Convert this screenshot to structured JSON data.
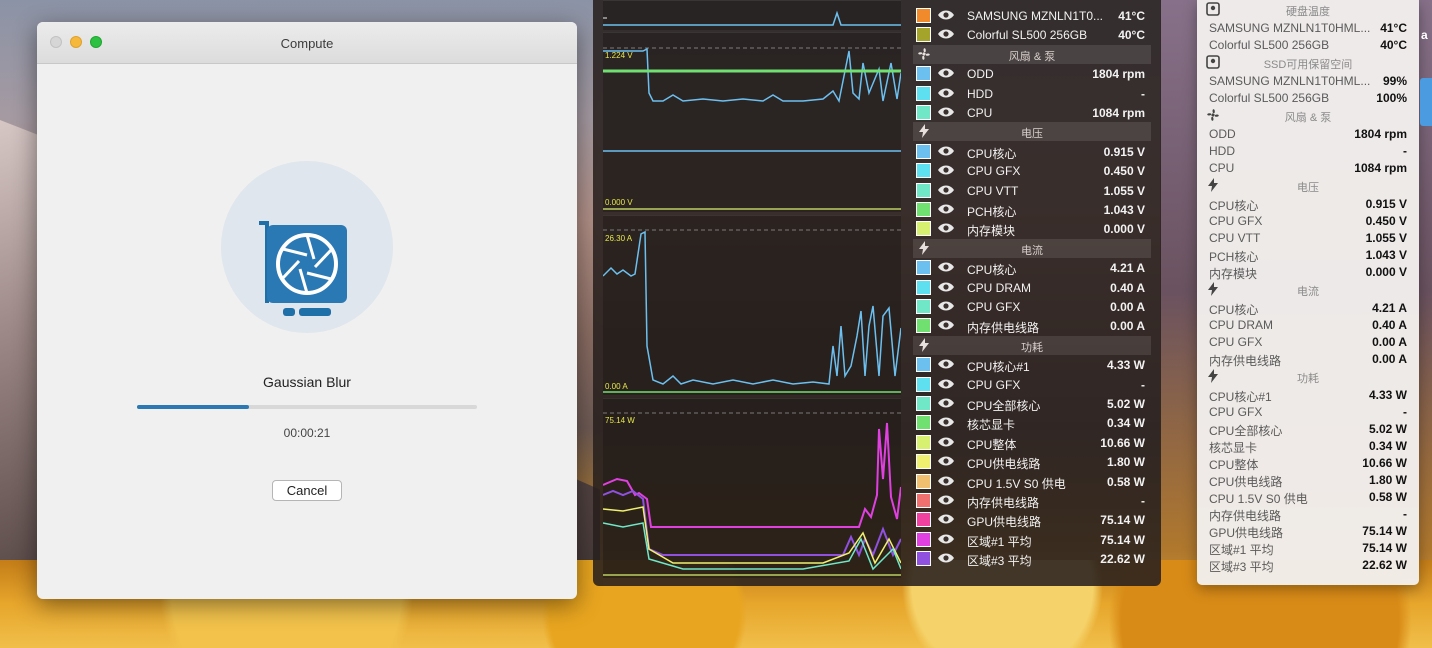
{
  "window": {
    "title": "Compute",
    "task": "Gaussian Blur",
    "progress": 0.33,
    "elapsed": "00:00:21",
    "cancel_label": "Cancel",
    "accent": "#2a79b5"
  },
  "graphs": {
    "voltage_top": "1.224 V",
    "voltage_bottom": "0.000 V",
    "current_top": "26.30 A",
    "current_bottom": "0.00 A",
    "power_top": "75.14 W"
  },
  "istat": {
    "sections": [
      {
        "kind": "row",
        "label": "SAMSUNG MZNLN1T0...",
        "value": "41°C",
        "color": "#f08a2a"
      },
      {
        "kind": "row",
        "label": "Colorful SL500 256GB",
        "value": "40°C",
        "color": "#a4a42a"
      },
      {
        "kind": "header",
        "label": "风扇 & 泵",
        "icon": "fan-icon"
      },
      {
        "kind": "row",
        "label": "ODD",
        "value": "1804 rpm",
        "color": "#6cc0f0"
      },
      {
        "kind": "row",
        "label": "HDD",
        "value": "-",
        "color": "#5fe0f0"
      },
      {
        "kind": "row",
        "label": "CPU",
        "value": "1084 rpm",
        "color": "#70e8c8"
      },
      {
        "kind": "header",
        "label": "电压",
        "icon": "lightning-icon"
      },
      {
        "kind": "row",
        "label": "CPU核心",
        "value": "0.915 V",
        "color": "#6cc0f0"
      },
      {
        "kind": "row",
        "label": "CPU GFX",
        "value": "0.450 V",
        "color": "#5fe0f0"
      },
      {
        "kind": "row",
        "label": "CPU VTT",
        "value": "1.055 V",
        "color": "#70e8c8"
      },
      {
        "kind": "row",
        "label": "PCH核心",
        "value": "1.043 V",
        "color": "#70e070"
      },
      {
        "kind": "row",
        "label": "内存模块",
        "value": "0.000 V",
        "color": "#d8f070"
      },
      {
        "kind": "header",
        "label": "电流",
        "icon": "lightning-icon"
      },
      {
        "kind": "row",
        "label": "CPU核心",
        "value": "4.21 A",
        "color": "#6cc0f0"
      },
      {
        "kind": "row",
        "label": "CPU DRAM",
        "value": "0.40 A",
        "color": "#5fe0f0"
      },
      {
        "kind": "row",
        "label": "CPU GFX",
        "value": "0.00 A",
        "color": "#70e8c8"
      },
      {
        "kind": "row",
        "label": "内存供电线路",
        "value": "0.00 A",
        "color": "#70e070"
      },
      {
        "kind": "header",
        "label": "功耗",
        "icon": "lightning-icon"
      },
      {
        "kind": "row",
        "label": "CPU核心#1",
        "value": "4.33 W",
        "color": "#6cc0f0"
      },
      {
        "kind": "row",
        "label": "CPU GFX",
        "value": "-",
        "color": "#5fe0f0"
      },
      {
        "kind": "row",
        "label": "CPU全部核心",
        "value": "5.02 W",
        "color": "#70e8c8"
      },
      {
        "kind": "row",
        "label": "核芯显卡",
        "value": "0.34 W",
        "color": "#70e070"
      },
      {
        "kind": "row",
        "label": "CPU整体",
        "value": "10.66 W",
        "color": "#d8f070"
      },
      {
        "kind": "row",
        "label": "CPU供电线路",
        "value": "1.80 W",
        "color": "#f0f070"
      },
      {
        "kind": "row",
        "label": "CPU 1.5V S0 供电",
        "value": "0.58 W",
        "color": "#f0c070"
      },
      {
        "kind": "row",
        "label": "内存供电线路",
        "value": "-",
        "color": "#f07070"
      },
      {
        "kind": "row",
        "label": "GPU供电线路",
        "value": "75.14 W",
        "color": "#f040a0"
      },
      {
        "kind": "row",
        "label": "区域#1 平均",
        "value": "75.14 W",
        "color": "#e040e0"
      },
      {
        "kind": "row",
        "label": "区域#3 平均",
        "value": "22.62 W",
        "color": "#9050e0"
      }
    ]
  },
  "dropdown": {
    "sections": [
      {
        "kind": "header",
        "label": "硬盘温度",
        "icon": "drive-icon"
      },
      {
        "kind": "row",
        "label": "SAMSUNG MZNLN1T0HML...",
        "value": "41°C"
      },
      {
        "kind": "row",
        "label": "Colorful SL500 256GB",
        "value": "40°C"
      },
      {
        "kind": "header",
        "label": "SSD可用保留空间",
        "icon": "ssd-icon"
      },
      {
        "kind": "row",
        "label": "SAMSUNG MZNLN1T0HML...",
        "value": "99%"
      },
      {
        "kind": "row",
        "label": "Colorful SL500 256GB",
        "value": "100%"
      },
      {
        "kind": "header",
        "label": "风扇 & 泵",
        "icon": "fan-icon"
      },
      {
        "kind": "row",
        "label": "ODD",
        "value": "1804 rpm"
      },
      {
        "kind": "row",
        "label": "HDD",
        "value": "-"
      },
      {
        "kind": "row",
        "label": "CPU",
        "value": "1084 rpm"
      },
      {
        "kind": "header",
        "label": "电压",
        "icon": "lightning-icon"
      },
      {
        "kind": "row",
        "label": "CPU核心",
        "value": "0.915 V"
      },
      {
        "kind": "row",
        "label": "CPU GFX",
        "value": "0.450 V"
      },
      {
        "kind": "row",
        "label": "CPU VTT",
        "value": "1.055 V"
      },
      {
        "kind": "row",
        "label": "PCH核心",
        "value": "1.043 V"
      },
      {
        "kind": "row",
        "label": "内存模块",
        "value": "0.000 V"
      },
      {
        "kind": "header",
        "label": "电流",
        "icon": "lightning-icon"
      },
      {
        "kind": "row",
        "label": "CPU核心",
        "value": "4.21 A"
      },
      {
        "kind": "row",
        "label": "CPU DRAM",
        "value": "0.40 A"
      },
      {
        "kind": "row",
        "label": "CPU GFX",
        "value": "0.00 A"
      },
      {
        "kind": "row",
        "label": "内存供电线路",
        "value": "0.00 A"
      },
      {
        "kind": "header",
        "label": "功耗",
        "icon": "lightning-icon"
      },
      {
        "kind": "row",
        "label": "CPU核心#1",
        "value": "4.33 W"
      },
      {
        "kind": "row",
        "label": "CPU GFX",
        "value": "-"
      },
      {
        "kind": "row",
        "label": "CPU全部核心",
        "value": "5.02 W"
      },
      {
        "kind": "row",
        "label": "核芯显卡",
        "value": "0.34 W"
      },
      {
        "kind": "row",
        "label": "CPU整体",
        "value": "10.66 W"
      },
      {
        "kind": "row",
        "label": "CPU供电线路",
        "value": "1.80 W"
      },
      {
        "kind": "row",
        "label": "CPU 1.5V S0 供电",
        "value": "0.58 W"
      },
      {
        "kind": "row",
        "label": "内存供电线路",
        "value": "-"
      },
      {
        "kind": "row",
        "label": "GPU供电线路",
        "value": "75.14 W"
      },
      {
        "kind": "row",
        "label": "区域#1 平均",
        "value": "75.14 W"
      },
      {
        "kind": "row",
        "label": "区域#3 平均",
        "value": "22.62 W"
      }
    ]
  },
  "edge_text": "a"
}
